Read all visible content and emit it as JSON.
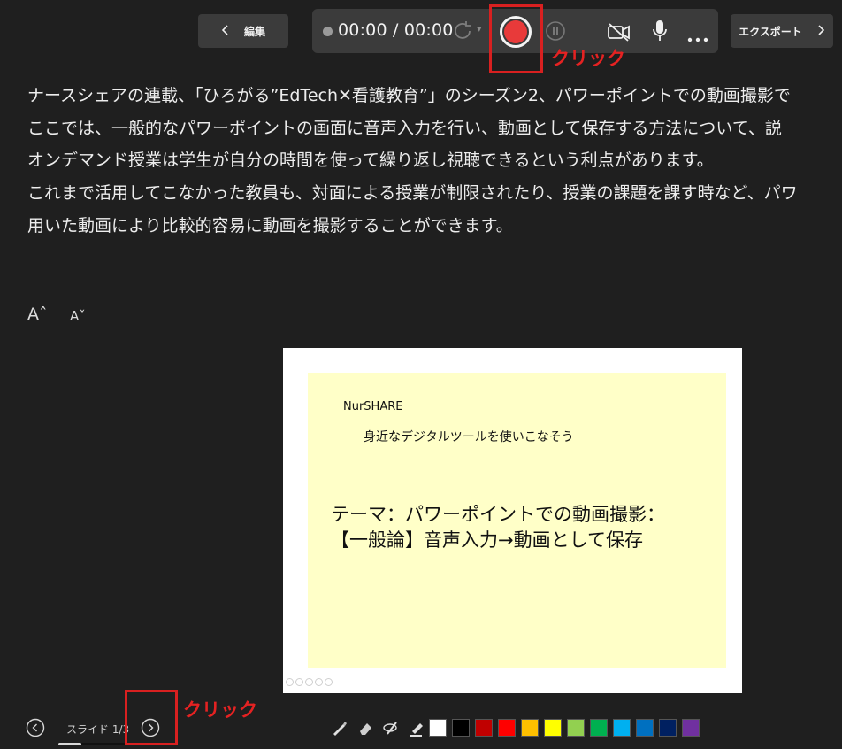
{
  "toolbar": {
    "edit_label": "編集",
    "time": "00:00 / 00:00",
    "export_label": "エクスポート"
  },
  "annotations": {
    "top_click": "クリック",
    "bottom_click": "クリック"
  },
  "notes": {
    "lines": [
      "ナースシェアの連載、「ひろがる”EdTech✕看護教育”」のシーズン2、パワーポイントでの動画撮影で",
      "ここでは、一般的なパワーポイントの画面に音声入力を行い、動画として保存する方法について、説",
      "オンデマンド授業は学生が自分の時間を使って繰り返し視聴できるという利点があります。",
      "これまで活用してこなかった教員も、対面による授業が制限されたり、授業の課題を課す時など、パワ",
      "用いた動画により比較的容易に動画を撮影することができます。"
    ],
    "font_up": "Aˆ",
    "font_down": "Aˇ"
  },
  "slide": {
    "brand": "NurSHARE",
    "tagline": "身近なデジタルツールを使いこなそう",
    "theme_line1": "テーマ：パワーポイントでの動画撮影：",
    "theme_line2": "【一般論】音声入力→動画として保存"
  },
  "navigation": {
    "counter": "スライド 1/3",
    "progress_fraction": 0.33
  },
  "ink_colors": [
    "#ffffff",
    "#000000",
    "#c00000",
    "#ff0000",
    "#ffc000",
    "#ffff00",
    "#92d050",
    "#00b050",
    "#00b0f0",
    "#0070c0",
    "#002060",
    "#7030a0"
  ],
  "colors": {
    "background": "#1f1f1f",
    "record": "#e83a3a",
    "annotation": "#e52222",
    "slide_fill": "#ffffc8"
  }
}
